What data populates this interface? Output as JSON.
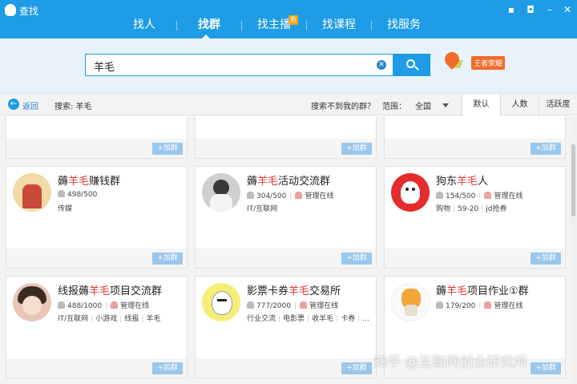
{
  "window": {
    "title": "查找"
  },
  "tabs": [
    {
      "label": "找人"
    },
    {
      "label": "找群"
    },
    {
      "label": "找主播",
      "badge": "热"
    },
    {
      "label": "找课程"
    },
    {
      "label": "找服务"
    }
  ],
  "search": {
    "value": "羊毛",
    "badge": "王者荣耀"
  },
  "filter": {
    "back": "返回",
    "search_label": "搜索: 羊毛",
    "not_found": "搜索不到我的群？",
    "range_label": "范围：",
    "range_value": "全国",
    "sort": [
      "默认",
      "人数",
      "活跃度"
    ]
  },
  "join_label": "+加群",
  "cards": [
    {
      "pre": "薅",
      "hl": "羊毛",
      "post": "赚钱群",
      "members": "498/500",
      "admin": "",
      "tags": [
        "传媒"
      ]
    },
    {
      "pre": "薅",
      "hl": "羊毛",
      "post": "活动交流群",
      "members": "304/500",
      "admin": "管理在线",
      "tags": [
        "IT/互联网"
      ]
    },
    {
      "pre": "狗东",
      "hl": "羊毛",
      "post": "人",
      "members": "154/500",
      "admin": "管理在线",
      "tags": [
        "购物",
        "59-20",
        "jd抢券"
      ]
    },
    {
      "pre": "线报薅",
      "hl": "羊毛",
      "post": "项目交流群",
      "members": "488/1000",
      "admin": "管理在线",
      "level": "1000",
      "tags": [
        "IT/互联网",
        "小游戏",
        "线报",
        "羊毛"
      ]
    },
    {
      "pre": "影票卡券",
      "hl": "羊毛",
      "post": "交易所",
      "members": "777/2000",
      "admin": "管理在线",
      "level": "2000",
      "tags": [
        "行业交流",
        "电影票",
        "收羊毛",
        "卡券",
        "..."
      ]
    },
    {
      "pre": "薅",
      "hl": "羊毛",
      "post": "项目作业①群",
      "members": "179/200",
      "admin": "管理在线",
      "tags": []
    }
  ],
  "watermark": "知乎 @互联网创业研究所",
  "colors": {
    "accent": "#1e9ce6",
    "highlight": "#e23a3a",
    "badge": "#f26b2a"
  }
}
